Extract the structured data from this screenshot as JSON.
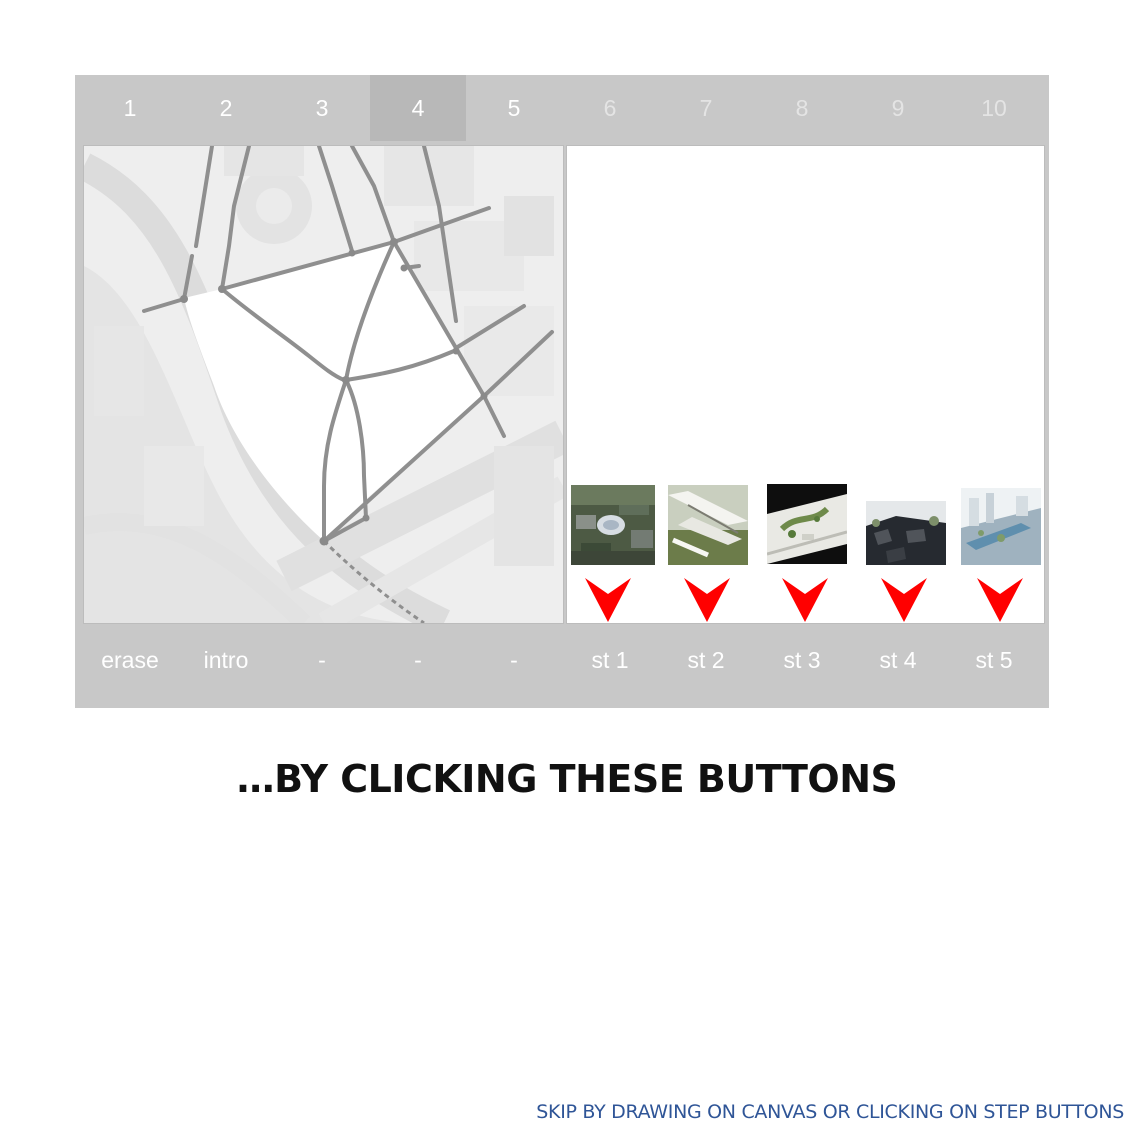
{
  "tabs": [
    {
      "label": "1",
      "state": "normal"
    },
    {
      "label": "2",
      "state": "normal"
    },
    {
      "label": "3",
      "state": "normal"
    },
    {
      "label": "4",
      "state": "active"
    },
    {
      "label": "5",
      "state": "normal"
    },
    {
      "label": "6",
      "state": "disabled"
    },
    {
      "label": "7",
      "state": "disabled"
    },
    {
      "label": "8",
      "state": "disabled"
    },
    {
      "label": "9",
      "state": "disabled"
    },
    {
      "label": "10",
      "state": "disabled"
    }
  ],
  "steps": [
    {
      "label": "erase"
    },
    {
      "label": "intro"
    },
    {
      "label": "-"
    },
    {
      "label": "-"
    },
    {
      "label": "-"
    },
    {
      "label": "st 1"
    },
    {
      "label": "st 2"
    },
    {
      "label": "st 3"
    },
    {
      "label": "st 4"
    },
    {
      "label": "st 5"
    }
  ],
  "thumbnails": [
    {
      "name": "st1-thumbnail",
      "icon": "aerial-city-photo"
    },
    {
      "name": "st2-thumbnail",
      "icon": "white-structure-render"
    },
    {
      "name": "st3-thumbnail",
      "icon": "site-model-photo"
    },
    {
      "name": "st4-thumbnail",
      "icon": "dark-roofs-render"
    },
    {
      "name": "st5-thumbnail",
      "icon": "blue-city-render"
    }
  ],
  "arrow_color": "#ff0000",
  "headline": "…BY CLICKING THESE BUTTONS",
  "skip_text": "SKIP BY DRAWING ON CANVAS OR CLICKING ON STEP BUTTONS",
  "colors": {
    "panel": "#c8c8c8",
    "active_tab": "#b8b8b8",
    "link": "#2f5597"
  }
}
